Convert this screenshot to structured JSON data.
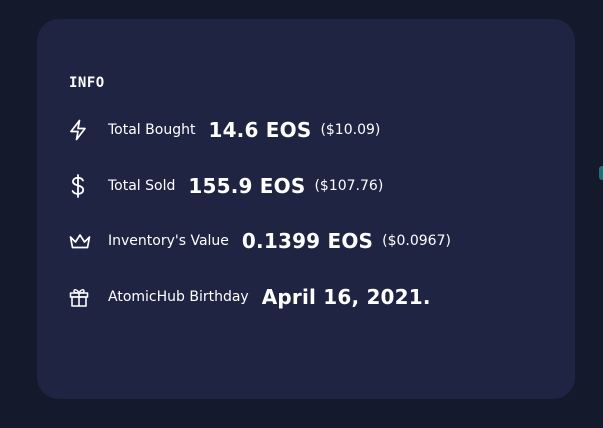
{
  "info": {
    "title": "INFO",
    "rows": [
      {
        "icon": "lightning-icon",
        "label": "Total Bought",
        "value": "14.6 EOS",
        "usd": "($10.09)"
      },
      {
        "icon": "dollar-icon",
        "label": "Total Sold",
        "value": "155.9 EOS",
        "usd": "($107.76)"
      },
      {
        "icon": "crown-icon",
        "label": "Inventory's Value",
        "value": "0.1399 EOS",
        "usd": "($0.0967)"
      },
      {
        "icon": "gift-icon",
        "label": "AtomicHub Birthday",
        "value": "April 16, 2021.",
        "usd": ""
      }
    ]
  },
  "colors": {
    "page_background": "#15192c",
    "card_background": "#1f2443",
    "text": "#ffffff"
  }
}
